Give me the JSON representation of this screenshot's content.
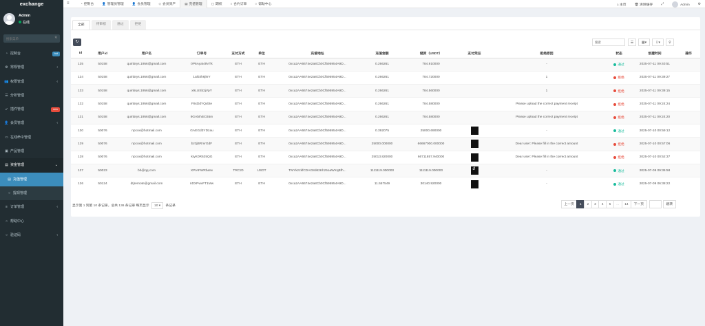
{
  "app": {
    "brand": "exchange"
  },
  "user": {
    "name": "Admin",
    "status": "在线"
  },
  "sidebar": {
    "search_placeholder": "搜索菜单",
    "items": [
      {
        "label": "控制台",
        "icon": "dashboard-icon",
        "badge": "hot",
        "badge_color": "#3c8dbc"
      },
      {
        "label": "常规管理",
        "icon": "cogs-icon",
        "arrow": "‹"
      },
      {
        "label": "权限管理",
        "icon": "group-icon",
        "arrow": "‹"
      },
      {
        "label": "分析管理",
        "icon": "tasks-icon"
      },
      {
        "label": "插件管理",
        "icon": "rocket-icon",
        "badge": "new",
        "badge_color": "#e74c3c"
      },
      {
        "label": "会员管理",
        "icon": "user-icon",
        "arrow": "‹"
      },
      {
        "label": "在线命令管理",
        "icon": "terminal-icon"
      },
      {
        "label": "产品管理",
        "icon": "cube-icon"
      },
      {
        "label": "资金管理",
        "icon": "money-icon",
        "arrow": "⌄",
        "open": true
      },
      {
        "label": "充值管理",
        "icon": "money-icon",
        "sub": true,
        "active": true
      },
      {
        "label": "提现管理",
        "icon": "circle-icon",
        "sub": true
      },
      {
        "label": "订单管理",
        "icon": "list-icon",
        "arrow": "‹"
      },
      {
        "label": "帮助中心",
        "icon": "circle-icon"
      },
      {
        "label": "验证码",
        "icon": "circle-icon",
        "arrow": "‹"
      }
    ]
  },
  "topnav": {
    "items": [
      {
        "label": "控制台",
        "icon": "dashboard-icon"
      },
      {
        "label": "管理员管理",
        "icon": "user-icon"
      },
      {
        "label": "会员管理",
        "icon": "user-icon"
      },
      {
        "label": "会员资产",
        "icon": "diamond-icon"
      },
      {
        "label": "充值管理",
        "icon": "money-icon",
        "active": true
      },
      {
        "label": "期权",
        "icon": "square-icon"
      },
      {
        "label": "合约订单",
        "icon": "circle-icon"
      },
      {
        "label": "帮助中心",
        "icon": "circle-icon"
      }
    ],
    "right": {
      "home": "主页",
      "clear_cache": "清除缓存",
      "admin": "Admin"
    }
  },
  "tabs": [
    "全部",
    "待审核",
    "通过",
    "拒绝"
  ],
  "toolbar": {
    "search_placeholder": "搜索"
  },
  "table": {
    "columns": [
      "Id",
      "用户id",
      "用户名",
      "订单号",
      "支付方式",
      "单位",
      "充值地址",
      "充值金额",
      "储资（USDT）",
      "支付凭证",
      "拒绝原因",
      "状态",
      "创建时间",
      "操作"
    ],
    "rows": [
      {
        "id": "135",
        "uid": "50158",
        "username": "quinbrys.1956@gmail.com",
        "order": "0P6Ayai49VTk",
        "pay": "ETH",
        "unit": "ETH",
        "address": "0xca2AA6674e2a8Cb0Cf595954A9D...",
        "amount": "0.266261",
        "usdt": "784.910000",
        "proof": "",
        "reason": "-",
        "status": "通过",
        "status_type": "ok",
        "time": "2025-07-11 09:40:51"
      },
      {
        "id": "134",
        "uid": "50158",
        "username": "quinbrys.1956@gmail.com",
        "order": "1al03h6jkrY",
        "pay": "ETH",
        "unit": "ETH",
        "address": "0xca2AA6674e2a8Cb0Cf595954A9D...",
        "amount": "0.266261",
        "usdt": "784.720000",
        "proof": "",
        "reason": "1",
        "status": "拒绝",
        "status_type": "no",
        "time": "2025-07-11 09:39:27"
      },
      {
        "id": "133",
        "uid": "50158",
        "username": "quinbrys.1956@gmail.com",
        "order": "x9LUSb2jVpY",
        "pay": "ETH",
        "unit": "ETH",
        "address": "0xca2AA6674e2a8Cb0Cf595954A9D...",
        "amount": "0.266261",
        "usdt": "784.560000",
        "proof": "",
        "reason": "1",
        "status": "拒绝",
        "status_type": "no",
        "time": "2025-07-11 09:39:15"
      },
      {
        "id": "132",
        "uid": "50158",
        "username": "quinbrys.1956@gmail.com",
        "order": "F8xDdYQxbte",
        "pay": "ETH",
        "unit": "ETH",
        "address": "0xca2AA6674e2a8Cb0Cf595954A9D...",
        "amount": "0.266261",
        "usdt": "784.580000",
        "proof": "",
        "reason": "Please upload the correct payment receipt",
        "status": "拒绝",
        "status_type": "no",
        "time": "2025-07-11 09:24:24"
      },
      {
        "id": "131",
        "uid": "50158",
        "username": "quinbrys.1956@gmail.com",
        "order": "9GAbih4iC65m",
        "pay": "ETH",
        "unit": "ETH",
        "address": "0xca2AA6674e2a8Cb0Cf595954A9D...",
        "amount": "0.266261",
        "usdt": "784.580000",
        "proof": "",
        "reason": "Please upload the correct payment receipt",
        "status": "拒绝",
        "status_type": "no",
        "time": "2025-07-11 09:24:20"
      },
      {
        "id": "130",
        "uid": "50076",
        "username": "npcox@hotmail.com",
        "order": "GAEGd3YDzau",
        "pay": "ETH",
        "unit": "ETH",
        "address": "0xca2AA6674e2a8Cb0Cf595954A9D...",
        "amount": "0.392075",
        "usdt": "25000.690000",
        "proof": "dark",
        "reason": "-",
        "status": "通过",
        "status_type": "ok",
        "time": "2025-07-10 00:59:12"
      },
      {
        "id": "129",
        "uid": "50076",
        "username": "npcox@hotmail.com",
        "order": "bz3jBRmrGdF",
        "pay": "ETH",
        "unit": "ETH",
        "address": "0xca2AA6674e2a8Cb0Cf595954A9D...",
        "amount": "25000.000000",
        "usdt": "66667000.000000",
        "proof": "dark",
        "reason": "Dear user: Please fill in the correct amount",
        "status": "拒绝",
        "status_type": "no",
        "time": "2025-07-10 00:57:06"
      },
      {
        "id": "128",
        "uid": "50076",
        "username": "npcox@hotmail.com",
        "order": "kIyK0R625QG",
        "pay": "ETH",
        "unit": "ETH",
        "address": "0xca2AA6674e2a8Cb0Cf595954A9D...",
        "amount": "25013.820000",
        "usdt": "66711857.940000",
        "proof": "dark",
        "reason": "Dear user: Please fill in the correct amount",
        "status": "拒绝",
        "status_type": "no",
        "time": "2025-07-10 00:52:37"
      },
      {
        "id": "127",
        "uid": "50023",
        "username": "bb@qq.com",
        "order": "XPIAFWRbaIw",
        "pay": "TRC20",
        "unit": "USDT",
        "address": "TMYkzzkfCDAG8d62Khz5oaWXqBfh...",
        "amount": "1111119.000000",
        "usdt": "1111119.000000",
        "proof": "logo",
        "reason": "-",
        "status": "通过",
        "status_type": "ok",
        "time": "2025-07-09 09:36:58"
      },
      {
        "id": "126",
        "uid": "50124",
        "username": "dtjremote@gmail.com",
        "order": "nDXPwvFT1Mw",
        "pay": "ETH",
        "unit": "ETH",
        "address": "0xca2AA6674e2a8Cb0Cf595954A9D...",
        "amount": "11.557549",
        "usdt": "30140.920000",
        "proof": "dark",
        "reason": "-",
        "status": "通过",
        "status_type": "ok",
        "time": "2025-07-09 06:38:22"
      }
    ]
  },
  "footer": {
    "info_prefix": "显示第 1 到第 10 条记录，总共 136 条记录 每页显示",
    "page_size": "10",
    "info_suffix": "条记录",
    "pager": [
      "上一页",
      "1",
      "2",
      "3",
      "4",
      "5",
      "...",
      "14",
      "下一页"
    ],
    "active_page": "1",
    "jump_label": "跳转"
  },
  "colors": {
    "sidebar_bg": "#222d32",
    "accent": "#3c8dbc",
    "ok": "#18bc9c",
    "danger": "#e74c3c"
  }
}
